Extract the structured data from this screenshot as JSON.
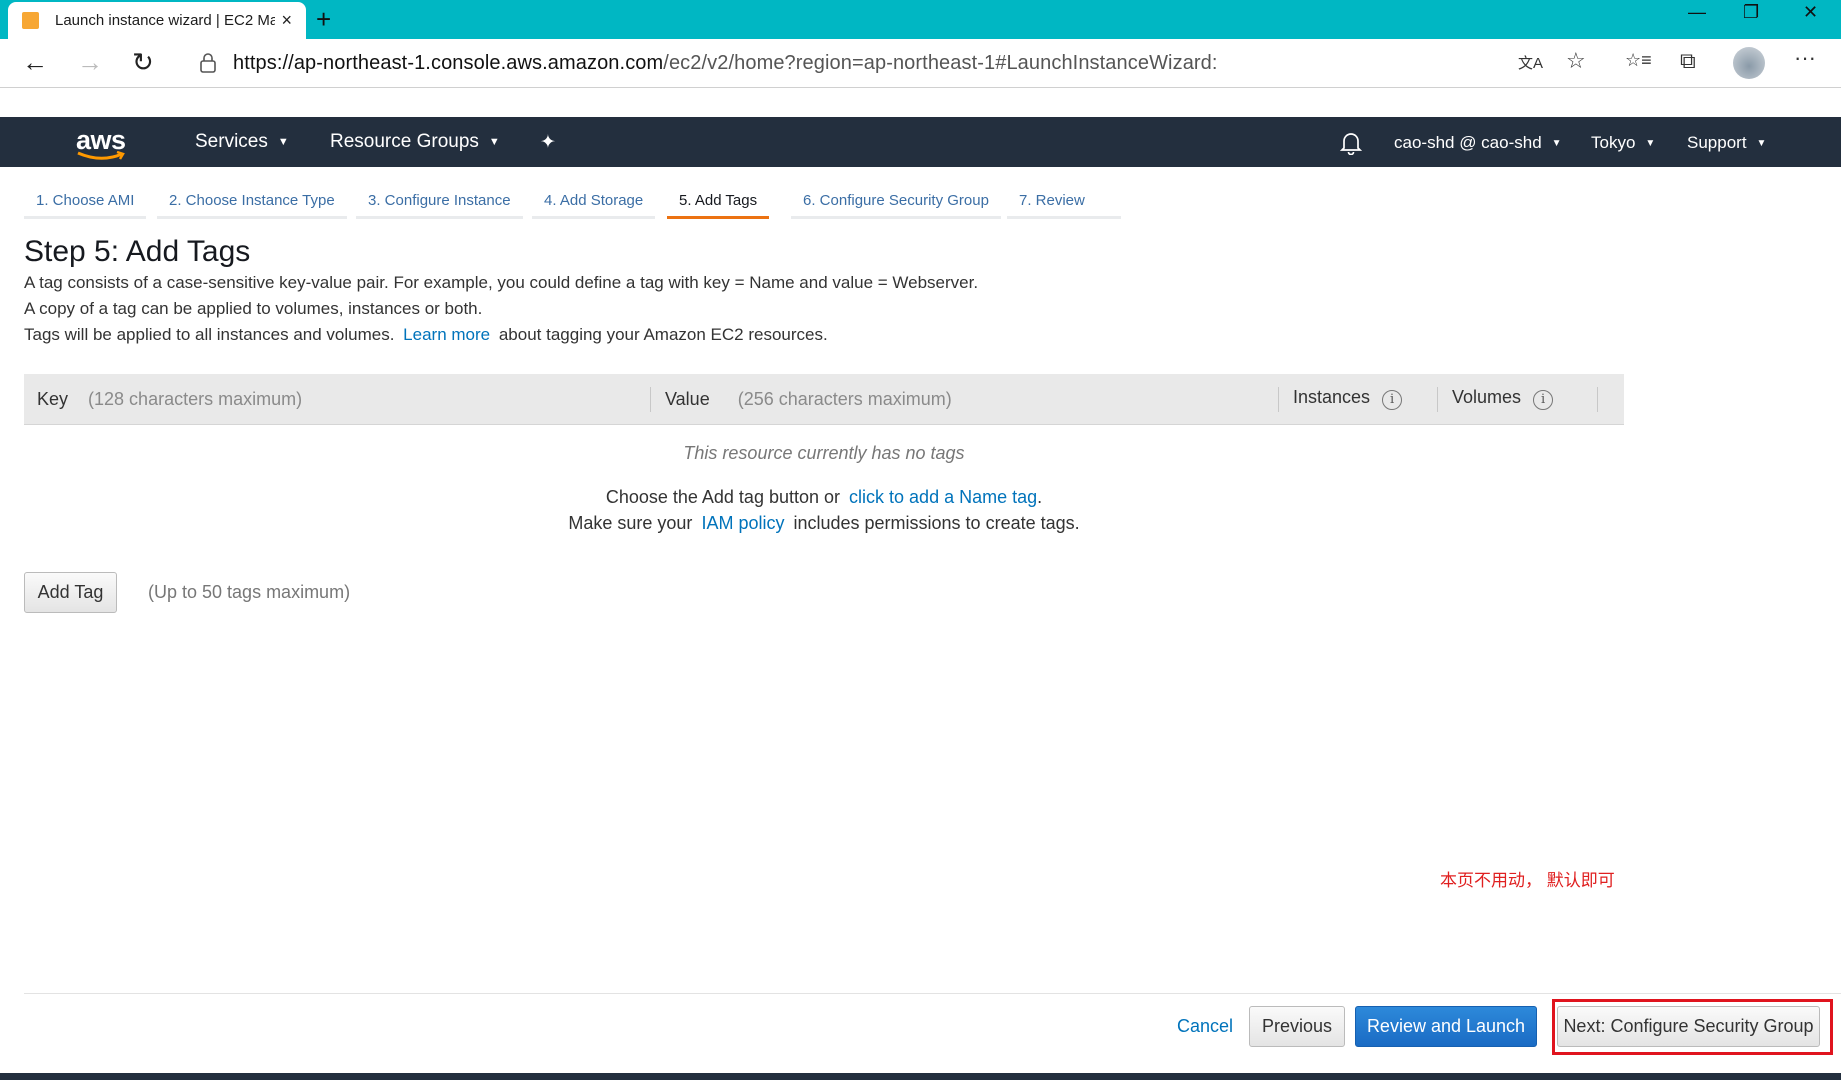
{
  "browser": {
    "tab_title": "Launch instance wizard | EC2 Ma",
    "new_tab": "+",
    "close_tab": "×",
    "url_host": "https://ap-northeast-1.console.aws.amazon.com",
    "url_path": "/ec2/v2/home?region=ap-northeast-1#LaunchInstanceWizard:",
    "window_controls": {
      "minimize": "—",
      "restore": "❐",
      "close": "✕"
    },
    "nav": {
      "back": "←",
      "forward": "→",
      "refresh": "↻"
    },
    "icons": {
      "translate": "文A",
      "favorite": "☆",
      "favorites": "☆≡",
      "collections": "⧉",
      "more": "···"
    }
  },
  "aws_header": {
    "logo": "aws",
    "services": "Services",
    "resource_groups": "Resource Groups",
    "pin": "✦",
    "bell": "🔔",
    "account": "cao-shd @ cao-shd",
    "region": "Tokyo",
    "support": "Support",
    "caret": "▼"
  },
  "steps": [
    {
      "label": "1. Choose AMI"
    },
    {
      "label": "2. Choose Instance Type"
    },
    {
      "label": "3. Configure Instance"
    },
    {
      "label": "4. Add Storage"
    },
    {
      "label": "5. Add Tags",
      "active": true
    },
    {
      "label": "6. Configure Security Group"
    },
    {
      "label": "7. Review"
    }
  ],
  "page": {
    "title": "Step 5: Add Tags",
    "line1": "A tag consists of a case-sensitive key-value pair. For example, you could define a tag with key = Name and value = Webserver.",
    "line2": "A copy of a tag can be applied to volumes, instances or both.",
    "line3_prefix": "Tags will be applied to all instances and volumes.",
    "line3_link": "Learn more",
    "line3_suffix": "about tagging your Amazon EC2 resources."
  },
  "table": {
    "key": "Key",
    "key_hint": "(128 characters maximum)",
    "value": "Value",
    "value_hint": "(256 characters maximum)",
    "instances": "Instances",
    "volumes": "Volumes",
    "info": "i",
    "empty_message": "This resource currently has no tags",
    "hint1_prefix": "Choose the Add tag button or",
    "hint1_link": "click to add a Name tag",
    "hint1_suffix": ".",
    "hint2_prefix": "Make sure your",
    "hint2_link": "IAM policy",
    "hint2_suffix": "includes permissions to create tags."
  },
  "add_tag": {
    "button": "Add Tag",
    "limit": "(Up to 50 tags maximum)"
  },
  "annotation": "本页不用动， 默认即可",
  "footer": {
    "cancel": "Cancel",
    "previous": "Previous",
    "review_launch": "Review and Launch",
    "next": "Next: Configure Security Group"
  }
}
